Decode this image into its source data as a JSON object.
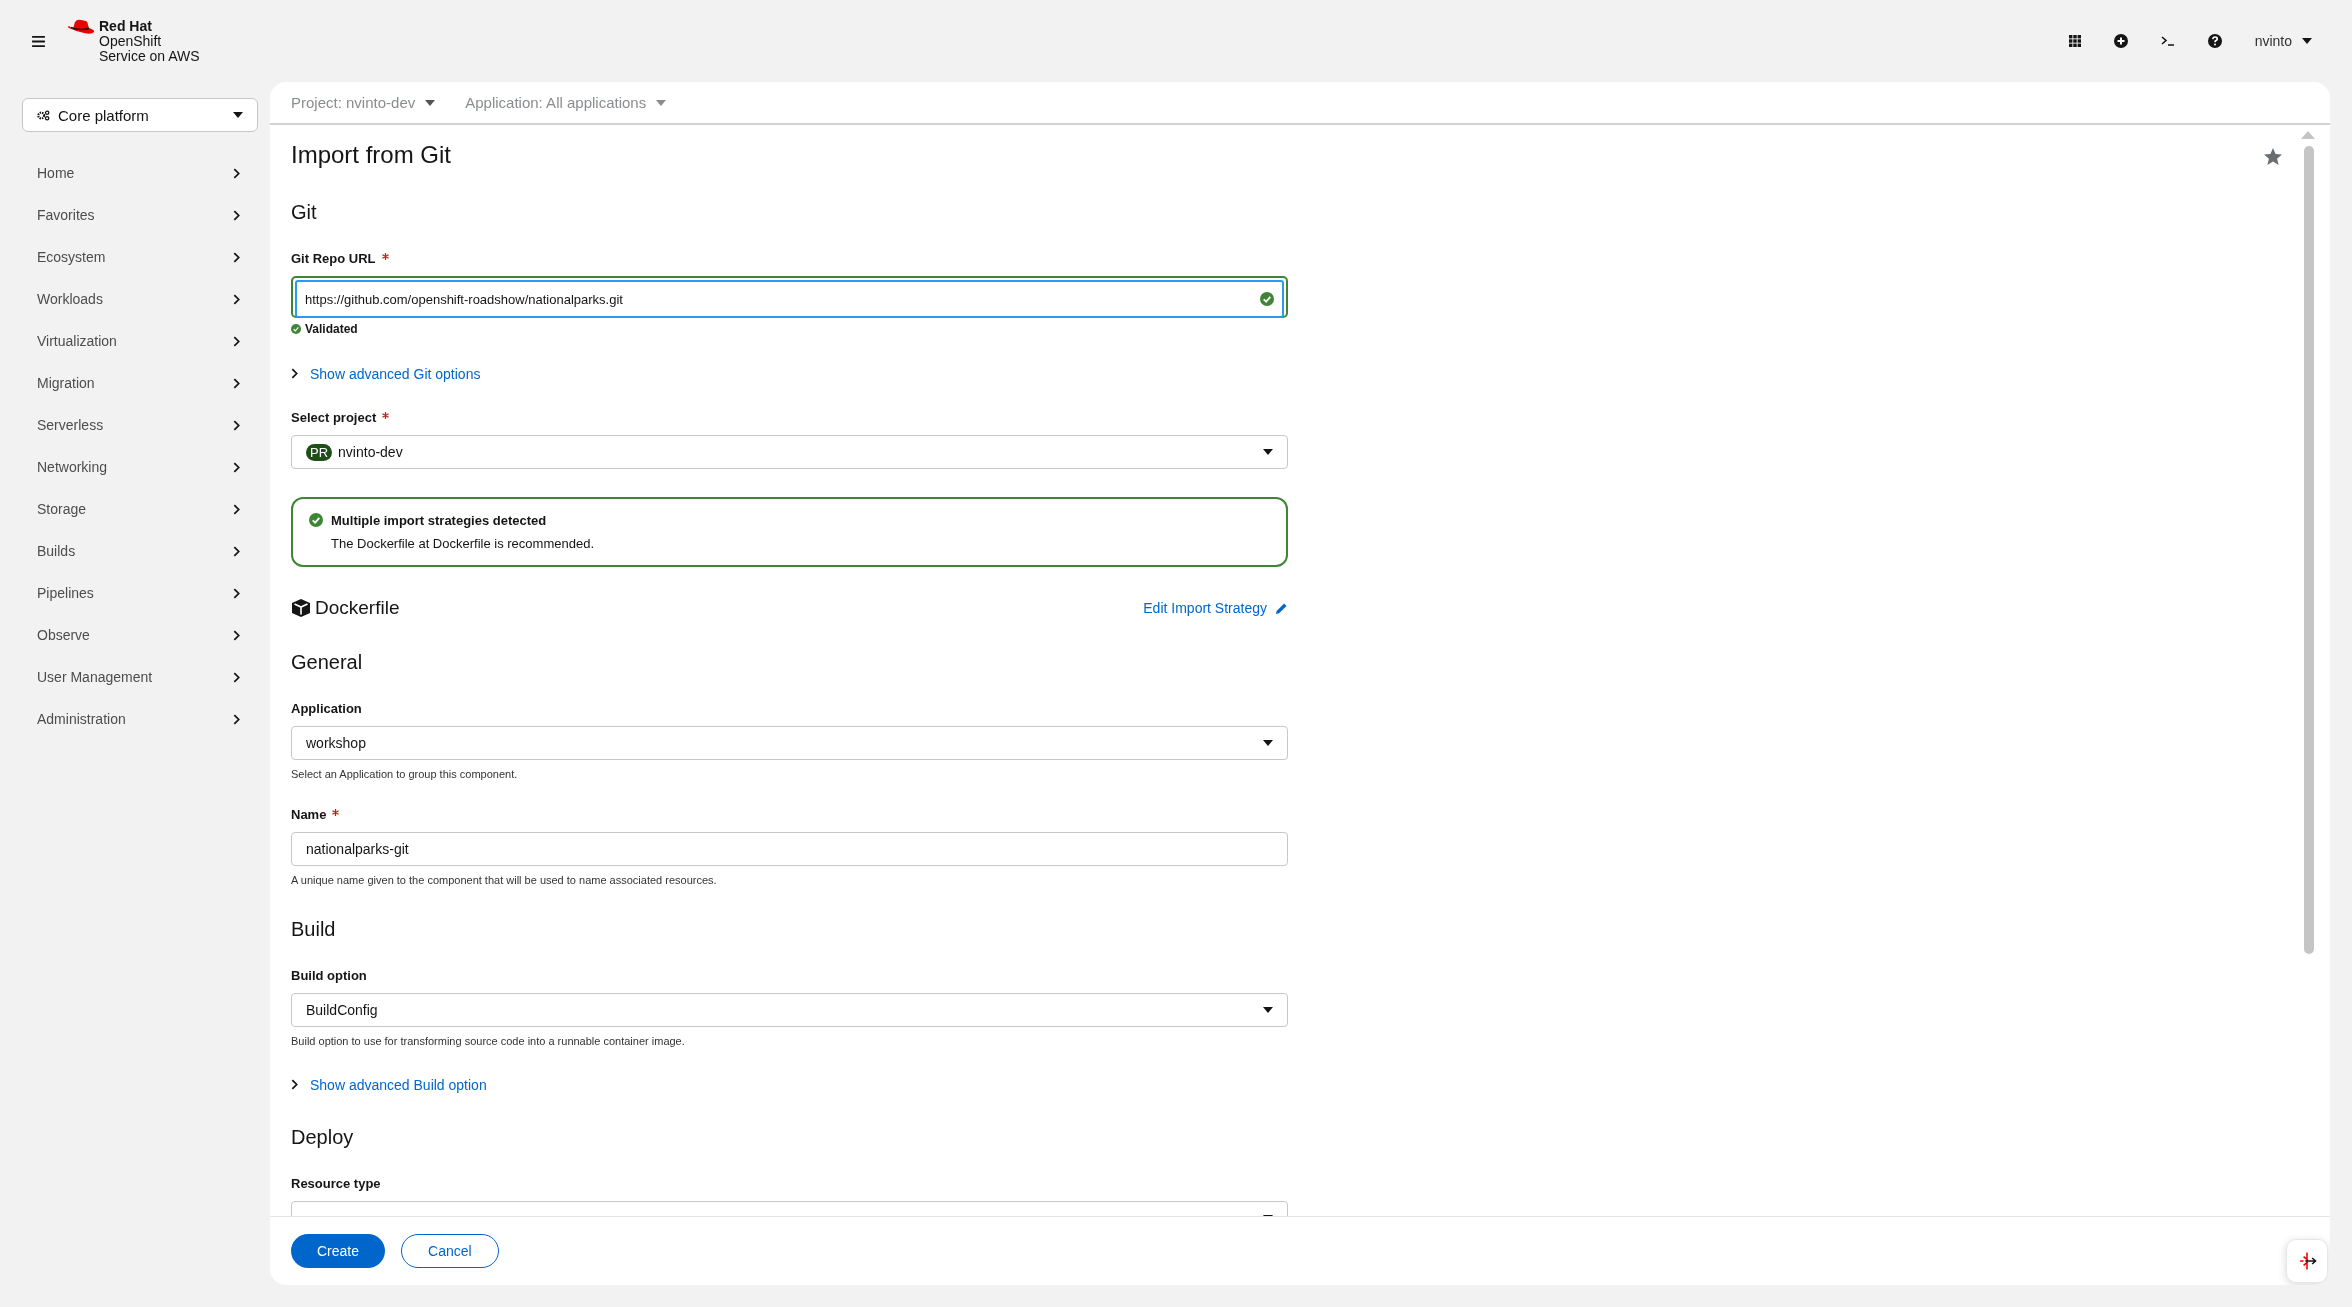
{
  "masthead": {
    "brand": [
      "Red Hat",
      "OpenShift",
      "Service on AWS"
    ],
    "user": "nvinto"
  },
  "perspective": {
    "label": "Core platform"
  },
  "sidebar": {
    "items": [
      {
        "label": "Home"
      },
      {
        "label": "Favorites"
      },
      {
        "label": "Ecosystem"
      },
      {
        "label": "Workloads"
      },
      {
        "label": "Virtualization"
      },
      {
        "label": "Migration"
      },
      {
        "label": "Serverless"
      },
      {
        "label": "Networking"
      },
      {
        "label": "Storage"
      },
      {
        "label": "Builds"
      },
      {
        "label": "Pipelines"
      },
      {
        "label": "Observe"
      },
      {
        "label": "User Management"
      },
      {
        "label": "Administration"
      }
    ]
  },
  "context_bar": {
    "project": "Project: nvinto-dev",
    "application": "Application: All applications"
  },
  "page": {
    "title": "Import from Git"
  },
  "sections": [
    {
      "heading": "Git",
      "items": [
        {
          "kind": "text",
          "label": "Git Repo URL",
          "required": true,
          "value": "https://github.com/openshift-roadshow/nationalparks.git",
          "validated": true,
          "status": "Validated"
        },
        {
          "kind": "link",
          "label": "Show advanced Git options"
        },
        {
          "kind": "select",
          "label": "Select project",
          "required": true,
          "badge": "PR",
          "value": "nvinto-dev"
        },
        {
          "kind": "alert",
          "title": "Multiple import strategies detected",
          "message": "The Dockerfile at Dockerfile is recommended."
        },
        {
          "kind": "strategy",
          "name": "Dockerfile",
          "link": "Edit Import Strategy"
        }
      ]
    },
    {
      "heading": "General",
      "items": [
        {
          "kind": "select",
          "label": "Application",
          "required": false,
          "value": "workshop",
          "helper": "Select an Application to group this component."
        },
        {
          "kind": "text",
          "label": "Name",
          "required": true,
          "value": "nationalparks-git",
          "validated": false,
          "helper": "A unique name given to the component that will be used to name associated resources."
        }
      ]
    },
    {
      "heading": "Build",
      "items": [
        {
          "kind": "select",
          "label": "Build option",
          "required": false,
          "value": "BuildConfig",
          "helper": "Build option to use for transforming source code into a runnable container image."
        },
        {
          "kind": "link",
          "label": "Show advanced Build option"
        }
      ]
    },
    {
      "heading": "Deploy",
      "items": [
        {
          "kind": "select",
          "label": "Resource type",
          "required": false
        }
      ]
    }
  ],
  "footer": {
    "buttons": [
      {
        "label": "Create",
        "kind": "primary"
      },
      {
        "label": "Cancel",
        "kind": "secondary"
      }
    ]
  }
}
